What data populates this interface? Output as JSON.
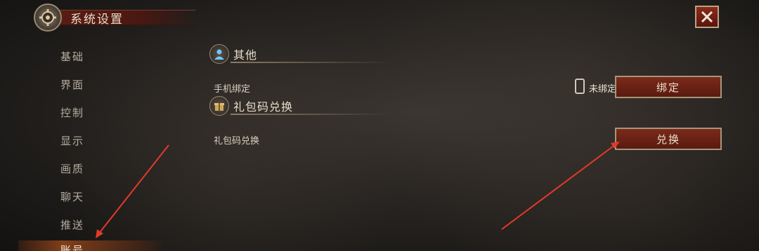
{
  "header": {
    "title": "系统设置"
  },
  "close_label": "✕",
  "sidebar": {
    "items": [
      {
        "label": "基础"
      },
      {
        "label": "界面"
      },
      {
        "label": "控制"
      },
      {
        "label": "显示"
      },
      {
        "label": "画质"
      },
      {
        "label": "聊天"
      },
      {
        "label": "推送"
      }
    ],
    "active": {
      "label": "账号"
    }
  },
  "sections": {
    "other": {
      "title": "其他"
    },
    "gift": {
      "title": "礼包码兑换"
    }
  },
  "phone": {
    "label": "手机绑定",
    "status": "未绑定",
    "button": "绑定"
  },
  "gift_code": {
    "label": "礼包码兑换",
    "button": "兑换"
  },
  "colors": {
    "accent": "#5a1a10",
    "arrow": "#e23a2a"
  }
}
